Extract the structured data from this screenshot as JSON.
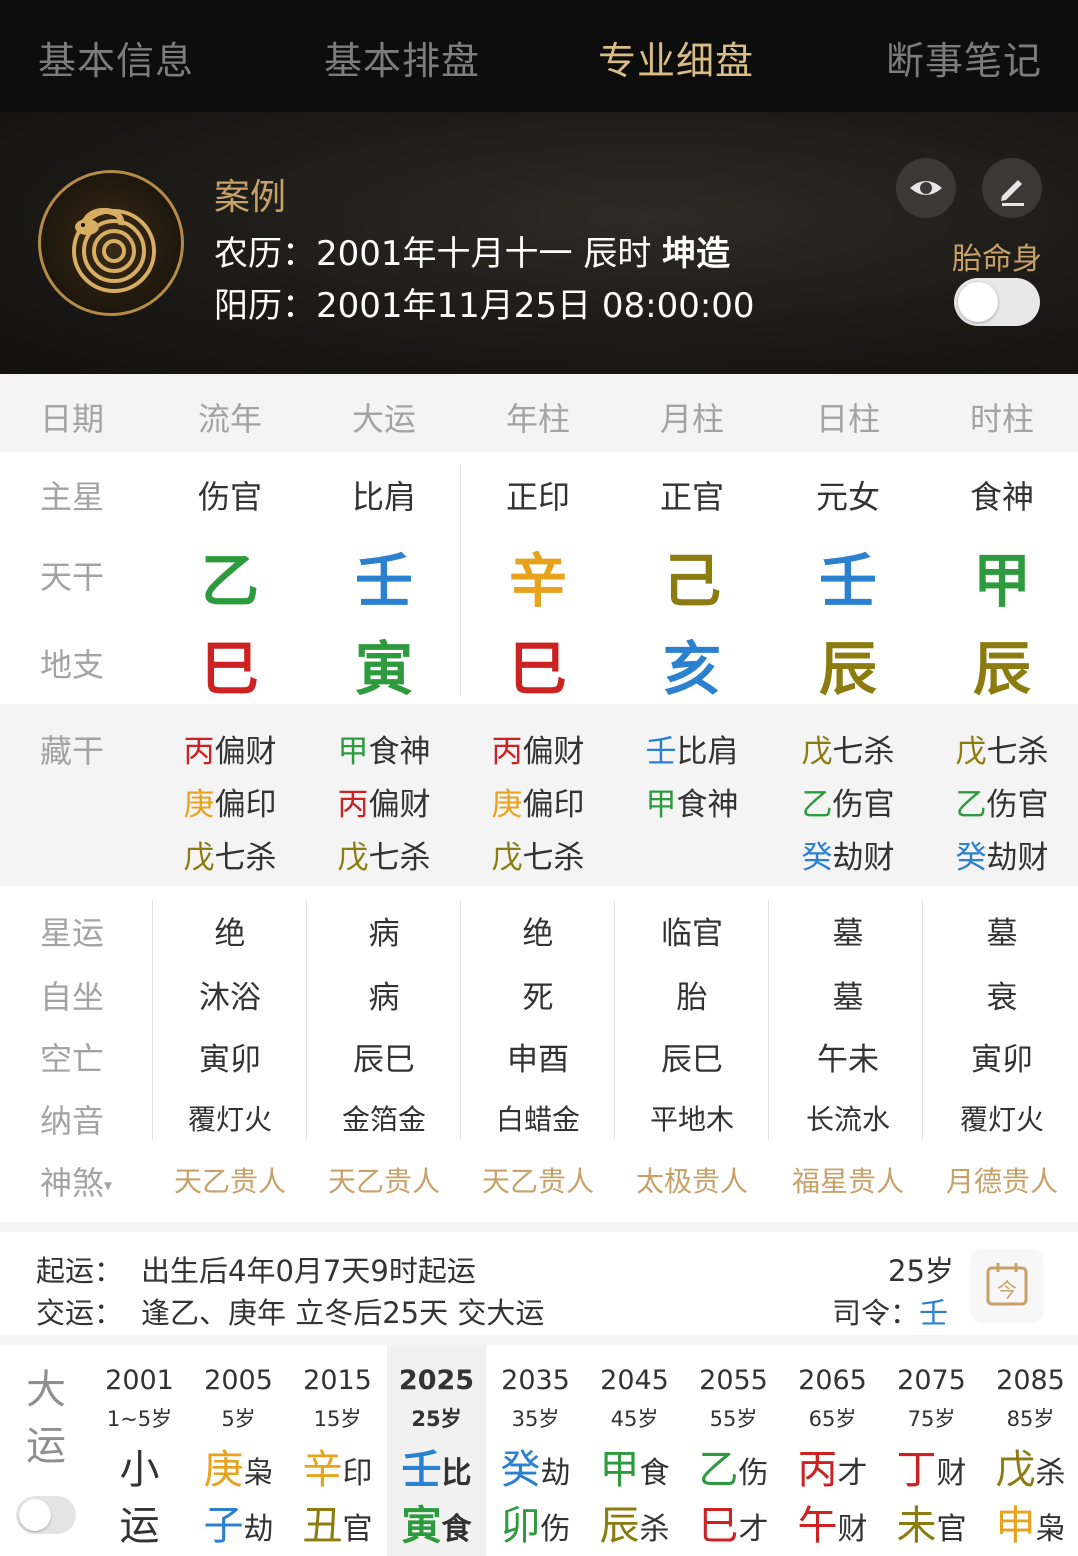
{
  "tabs": [
    "基本信息",
    "基本排盘",
    "专业细盘",
    "断事笔记"
  ],
  "colors": {
    "wood": "#2e9a3e",
    "water": "#2b80cf",
    "metal": "#e8a21c",
    "earth": "#8c7c10",
    "fire": "#cc2222",
    "gold_text": "#c8a169"
  },
  "header": {
    "case_name": "案例",
    "lunar_label": "农历：",
    "lunar_value": "2001年十月十一 辰时",
    "gender": "坤造",
    "solar_label": "阳历：",
    "solar_value": "2001年11月25日 08:00:00",
    "toggle_label": "胎命身",
    "icons": [
      "eye-icon",
      "pencil-icon"
    ]
  },
  "grid": {
    "columns": [
      "日期",
      "流年",
      "大运",
      "年柱",
      "月柱",
      "日柱",
      "时柱"
    ],
    "row_labels": {
      "main_star": "主星",
      "stem": "天干",
      "branch": "地支",
      "hidden": "藏干",
      "star_luck": "星运",
      "self_seat": "自坐",
      "kongwang": "空亡",
      "nayin": "纳音",
      "shensha": "神煞"
    },
    "main_star": [
      "伤官",
      "比肩",
      "正印",
      "正官",
      "元女",
      "食神"
    ],
    "stems": [
      {
        "char": "乙",
        "color": "#2e9a3e"
      },
      {
        "char": "壬",
        "color": "#2b80cf"
      },
      {
        "char": "辛",
        "color": "#e8a21c"
      },
      {
        "char": "己",
        "color": "#8c7c10"
      },
      {
        "char": "壬",
        "color": "#2b80cf"
      },
      {
        "char": "甲",
        "color": "#2e9a3e"
      }
    ],
    "branches": [
      {
        "char": "巳",
        "color": "#cc2222"
      },
      {
        "char": "寅",
        "color": "#2e9a3e"
      },
      {
        "char": "巳",
        "color": "#cc2222"
      },
      {
        "char": "亥",
        "color": "#2b80cf"
      },
      {
        "char": "辰",
        "color": "#8c7c10"
      },
      {
        "char": "辰",
        "color": "#8c7c10"
      }
    ],
    "hidden": [
      [
        {
          "g": "丙",
          "t": "偏财",
          "c": "#cc2222"
        },
        {
          "g": "庚",
          "t": "偏印",
          "c": "#e8a21c"
        },
        {
          "g": "戊",
          "t": "七杀",
          "c": "#8c7c10"
        }
      ],
      [
        {
          "g": "甲",
          "t": "食神",
          "c": "#2e9a3e"
        },
        {
          "g": "丙",
          "t": "偏财",
          "c": "#cc2222"
        },
        {
          "g": "戊",
          "t": "七杀",
          "c": "#8c7c10"
        }
      ],
      [
        {
          "g": "丙",
          "t": "偏财",
          "c": "#cc2222"
        },
        {
          "g": "庚",
          "t": "偏印",
          "c": "#e8a21c"
        },
        {
          "g": "戊",
          "t": "七杀",
          "c": "#8c7c10"
        }
      ],
      [
        {
          "g": "壬",
          "t": "比肩",
          "c": "#2b80cf"
        },
        {
          "g": "甲",
          "t": "食神",
          "c": "#2e9a3e"
        }
      ],
      [
        {
          "g": "戊",
          "t": "七杀",
          "c": "#8c7c10"
        },
        {
          "g": "乙",
          "t": "伤官",
          "c": "#2e9a3e"
        },
        {
          "g": "癸",
          "t": "劫财",
          "c": "#2b80cf"
        }
      ],
      [
        {
          "g": "戊",
          "t": "七杀",
          "c": "#8c7c10"
        },
        {
          "g": "乙",
          "t": "伤官",
          "c": "#2e9a3e"
        },
        {
          "g": "癸",
          "t": "劫财",
          "c": "#2b80cf"
        }
      ]
    ],
    "star_luck": [
      "绝",
      "病",
      "绝",
      "临官",
      "墓",
      "墓"
    ],
    "self_seat": [
      "沐浴",
      "病",
      "死",
      "胎",
      "墓",
      "衰"
    ],
    "kongwang": [
      "寅卯",
      "辰巳",
      "申酉",
      "辰巳",
      "午未",
      "寅卯"
    ],
    "nayin": [
      "覆灯火",
      "金箔金",
      "白蜡金",
      "平地木",
      "长流水",
      "覆灯火"
    ],
    "shensha": [
      "天乙贵人",
      "天乙贵人",
      "天乙贵人",
      "太极贵人",
      "福星贵人",
      "月德贵人"
    ]
  },
  "qiyun": {
    "start_label": "起运：",
    "start_value": "出生后4年0月7天9时起运",
    "jiao_label": "交运：",
    "jiao_value": "逢乙、庚年 立冬后25天 交大运",
    "age": "25岁",
    "siling_label": "司令：",
    "siling_value": "壬",
    "cal_char": "今"
  },
  "dayun": {
    "label": "大运",
    "columns": [
      {
        "year": "2001",
        "age": "1~5岁",
        "g1": "小",
        "g1c": "#333333",
        "s1": "",
        "g2": "运",
        "g2c": "#333333",
        "s2": ""
      },
      {
        "year": "2005",
        "age": "5岁",
        "g1": "庚",
        "g1c": "#e8a21c",
        "s1": "枭",
        "g2": "子",
        "g2c": "#2b80cf",
        "s2": "劫"
      },
      {
        "year": "2015",
        "age": "15岁",
        "g1": "辛",
        "g1c": "#e8a21c",
        "s1": "印",
        "g2": "丑",
        "g2c": "#8c7c10",
        "s2": "官"
      },
      {
        "year": "2025",
        "age": "25岁",
        "g1": "壬",
        "g1c": "#2b80cf",
        "s1": "比",
        "g2": "寅",
        "g2c": "#2e9a3e",
        "s2": "食",
        "current": true
      },
      {
        "year": "2035",
        "age": "35岁",
        "g1": "癸",
        "g1c": "#2b80cf",
        "s1": "劫",
        "g2": "卯",
        "g2c": "#2e9a3e",
        "s2": "伤"
      },
      {
        "year": "2045",
        "age": "45岁",
        "g1": "甲",
        "g1c": "#2e9a3e",
        "s1": "食",
        "g2": "辰",
        "g2c": "#8c7c10",
        "s2": "杀"
      },
      {
        "year": "2055",
        "age": "55岁",
        "g1": "乙",
        "g1c": "#2e9a3e",
        "s1": "伤",
        "g2": "巳",
        "g2c": "#cc2222",
        "s2": "才"
      },
      {
        "year": "2065",
        "age": "65岁",
        "g1": "丙",
        "g1c": "#cc2222",
        "s1": "才",
        "g2": "午",
        "g2c": "#cc2222",
        "s2": "财"
      },
      {
        "year": "2075",
        "age": "75岁",
        "g1": "丁",
        "g1c": "#cc2222",
        "s1": "财",
        "g2": "未",
        "g2c": "#8c7c10",
        "s2": "官"
      },
      {
        "year": "2085",
        "age": "85岁",
        "g1": "戊",
        "g1c": "#8c7c10",
        "s1": "杀",
        "g2": "申",
        "g2c": "#e8a21c",
        "s2": "枭"
      }
    ]
  }
}
